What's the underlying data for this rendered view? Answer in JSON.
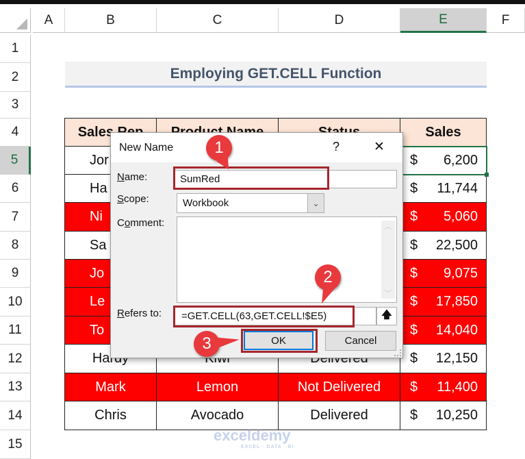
{
  "columns": [
    "A",
    "B",
    "C",
    "D",
    "E",
    "F"
  ],
  "selected_column": "E",
  "rows": [
    "1",
    "2",
    "3",
    "4",
    "5",
    "6",
    "7",
    "8",
    "9",
    "10",
    "11",
    "12",
    "13",
    "14",
    "15"
  ],
  "selected_row": "5",
  "title": "Employing GET.CELL Function",
  "table": {
    "headers": [
      "Sales Rep",
      "Product Name",
      "Status",
      "Sales"
    ],
    "rows": [
      {
        "b": "Jor",
        "c": "",
        "d": "",
        "currency": "$",
        "sales": "6,200",
        "red": false,
        "partial": true
      },
      {
        "b": "Ha",
        "c": "",
        "d": "",
        "currency": "$",
        "sales": "11,744",
        "red": false,
        "partial": true
      },
      {
        "b": "Ni",
        "c": "",
        "d": "",
        "currency": "$",
        "sales": "5,060",
        "red": true,
        "partial": true
      },
      {
        "b": "Sa",
        "c": "",
        "d": "",
        "currency": "$",
        "sales": "22,500",
        "red": false,
        "partial": true
      },
      {
        "b": "Jo",
        "c": "",
        "d": "",
        "currency": "$",
        "sales": "9,075",
        "red": true,
        "partial": true
      },
      {
        "b": "Le",
        "c": "",
        "d": "",
        "currency": "$",
        "sales": "17,850",
        "red": true,
        "partial": true
      },
      {
        "b": "To",
        "c": "",
        "d": "",
        "currency": "$",
        "sales": "14,040",
        "red": true,
        "partial": true
      },
      {
        "b": "Hardy",
        "c": "Kiwi",
        "d": "Delivered",
        "currency": "$",
        "sales": "12,150",
        "red": false,
        "partial": false
      },
      {
        "b": "Mark",
        "c": "Lemon",
        "d": "Not Delivered",
        "currency": "$",
        "sales": "11,400",
        "red": true,
        "partial": false
      },
      {
        "b": "Chris",
        "c": "Avocado",
        "d": "Delivered",
        "currency": "$",
        "sales": "10,250",
        "red": false,
        "partial": false
      }
    ]
  },
  "dialog": {
    "title": "New Name",
    "help": "?",
    "close": "✕",
    "name_label_u": "N",
    "name_label": "ame:",
    "name_value": "SumRed",
    "scope_label_u": "S",
    "scope_label": "cope:",
    "scope_value": "Workbook",
    "comment_label_a": "C",
    "comment_label_u": "o",
    "comment_label": "mment:",
    "comment_value": "",
    "refers_label_u": "R",
    "refers_label": "efers to:",
    "refers_value": "=GET.CELL(63,GET.CELL!$E5)",
    "ok": "OK",
    "cancel": "Cancel"
  },
  "callouts": [
    "1",
    "2",
    "3"
  ],
  "watermark": {
    "brand": "exceldemy",
    "tagline": "EXCEL · DATA · BI"
  },
  "colors": {
    "red": "#ff0000",
    "header": "#fce4d6",
    "callout": "#e8393d",
    "highlight": "#a4262c",
    "excel_green": "#217346"
  }
}
